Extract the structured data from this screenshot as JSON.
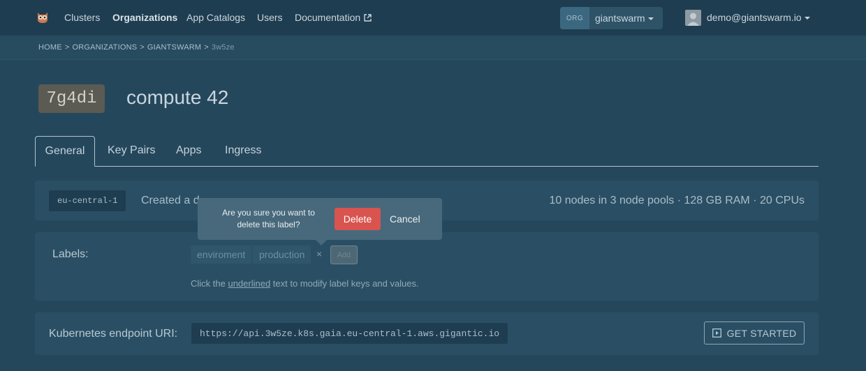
{
  "nav": {
    "logo_icon": "giantswarm-owl-icon",
    "links": [
      "Clusters",
      "Organizations",
      "App Catalogs",
      "Users",
      "Documentation"
    ],
    "active": "Organizations",
    "external_icon": "external-link-icon",
    "org_tag": "ORG",
    "org_name": "giantswarm",
    "user_email": "demo@giantswarm.io"
  },
  "breadcrumb": {
    "items": [
      "HOME",
      "ORGANIZATIONS",
      "GIANTSWARM"
    ],
    "current": "3w5ze",
    "separator": ">"
  },
  "cluster": {
    "id": "7g4di",
    "name": "compute 42"
  },
  "tabs": [
    "General",
    "Key Pairs",
    "Apps",
    "Ingress"
  ],
  "active_tab": "General",
  "summary": {
    "region": "eu-central-1",
    "created_prefix": "Created a d",
    "stats": "10 nodes in 3 node pools · 128 GB RAM · 20 CPUs"
  },
  "labels": {
    "title": "Labels:",
    "items": [
      {
        "key": "enviroment",
        "value": "production"
      }
    ],
    "remove_glyph": "×",
    "add_label": "Add",
    "hint_before": "Click the ",
    "hint_underlined": "underlined",
    "hint_after": " text to modify label keys and values."
  },
  "endpoint": {
    "label": "Kubernetes endpoint URI:",
    "uri": "https://api.3w5ze.k8s.gaia.eu-central-1.aws.gigantic.io",
    "button": "GET STARTED",
    "button_icon": "play-square-icon"
  },
  "popover": {
    "message": "Are you sure you want to delete this label?",
    "delete": "Delete",
    "cancel": "Cancel"
  },
  "colors": {
    "background": "#25475b",
    "delete": "#d9534f",
    "popover": "#48697c"
  }
}
